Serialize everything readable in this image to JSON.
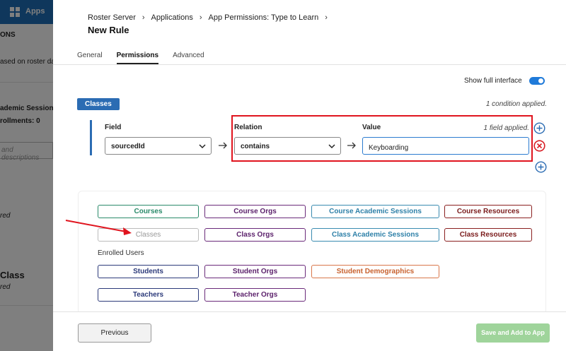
{
  "background": {
    "apps_label": "Apps",
    "section_title": "ONS",
    "desc_text": "ased on roster da",
    "academic_sessions": "ademic Sessions",
    "enrollments": "rollments: 0",
    "search_placeholder": "and descriptions",
    "status_1": "red",
    "class_title": "Class",
    "status_2": "red"
  },
  "breadcrumb": [
    "Roster Server",
    "Applications",
    "App Permissions: Type to Learn"
  ],
  "page_title": "New Rule",
  "tabs": [
    {
      "label": "General",
      "active": false
    },
    {
      "label": "Permissions",
      "active": true
    },
    {
      "label": "Advanced",
      "active": false
    }
  ],
  "toggle": {
    "label": "Show full interface",
    "on": true
  },
  "condition_group": {
    "name": "Classes",
    "applied_text": "1 condition applied."
  },
  "condition": {
    "field_label": "Field",
    "field_value": "sourcedId",
    "relation_label": "Relation",
    "relation_value": "contains",
    "value_label": "Value",
    "value_applied": "1 field applied.",
    "value_input": "Keyboarding"
  },
  "resources": {
    "row1": [
      {
        "label": "Courses",
        "color": "#2a8a6a",
        "text_color": "#2a8a6a"
      },
      {
        "label": "Course Orgs",
        "color": "#6a2a7a",
        "text_color": "#5a1f6a"
      },
      {
        "label": "Course Academic Sessions",
        "color": "#3a8bb0",
        "text_color": "#2e80a8"
      },
      {
        "label": "Course Resources",
        "color": "#8a1f1f",
        "text_color": "#7a1a1a"
      }
    ],
    "row2": [
      {
        "label": "Classes",
        "color": "#bbbbbb",
        "text_color": "#999999"
      },
      {
        "label": "Class Orgs",
        "color": "#6a2a7a",
        "text_color": "#5a1f6a"
      },
      {
        "label": "Class Academic Sessions",
        "color": "#3a8bb0",
        "text_color": "#2e80a8"
      },
      {
        "label": "Class Resources",
        "color": "#8a1f1f",
        "text_color": "#7a1a1a"
      }
    ],
    "enrolled_users_label": "Enrolled Users",
    "row3": [
      {
        "label": "Students",
        "color": "#2c3a7a",
        "text_color": "#2c3a7a"
      },
      {
        "label": "Student Orgs",
        "color": "#6a2a7a",
        "text_color": "#5a1f6a"
      },
      {
        "label": "Student Demographics",
        "color": "#d9774a",
        "text_color": "#c8612e"
      }
    ],
    "row4": [
      {
        "label": "Teachers",
        "color": "#2c3a7a",
        "text_color": "#2c3a7a"
      },
      {
        "label": "Teacher Orgs",
        "color": "#6a2a7a",
        "text_color": "#5a1f6a"
      }
    ]
  },
  "footer": {
    "previous_label": "Previous",
    "save_label": "Save and Add to App"
  },
  "colors": {
    "primary": "#2b6cb3",
    "annotation_red": "#e0141e",
    "remove_red": "#d81f26",
    "save_disabled": "#9fd49b"
  }
}
